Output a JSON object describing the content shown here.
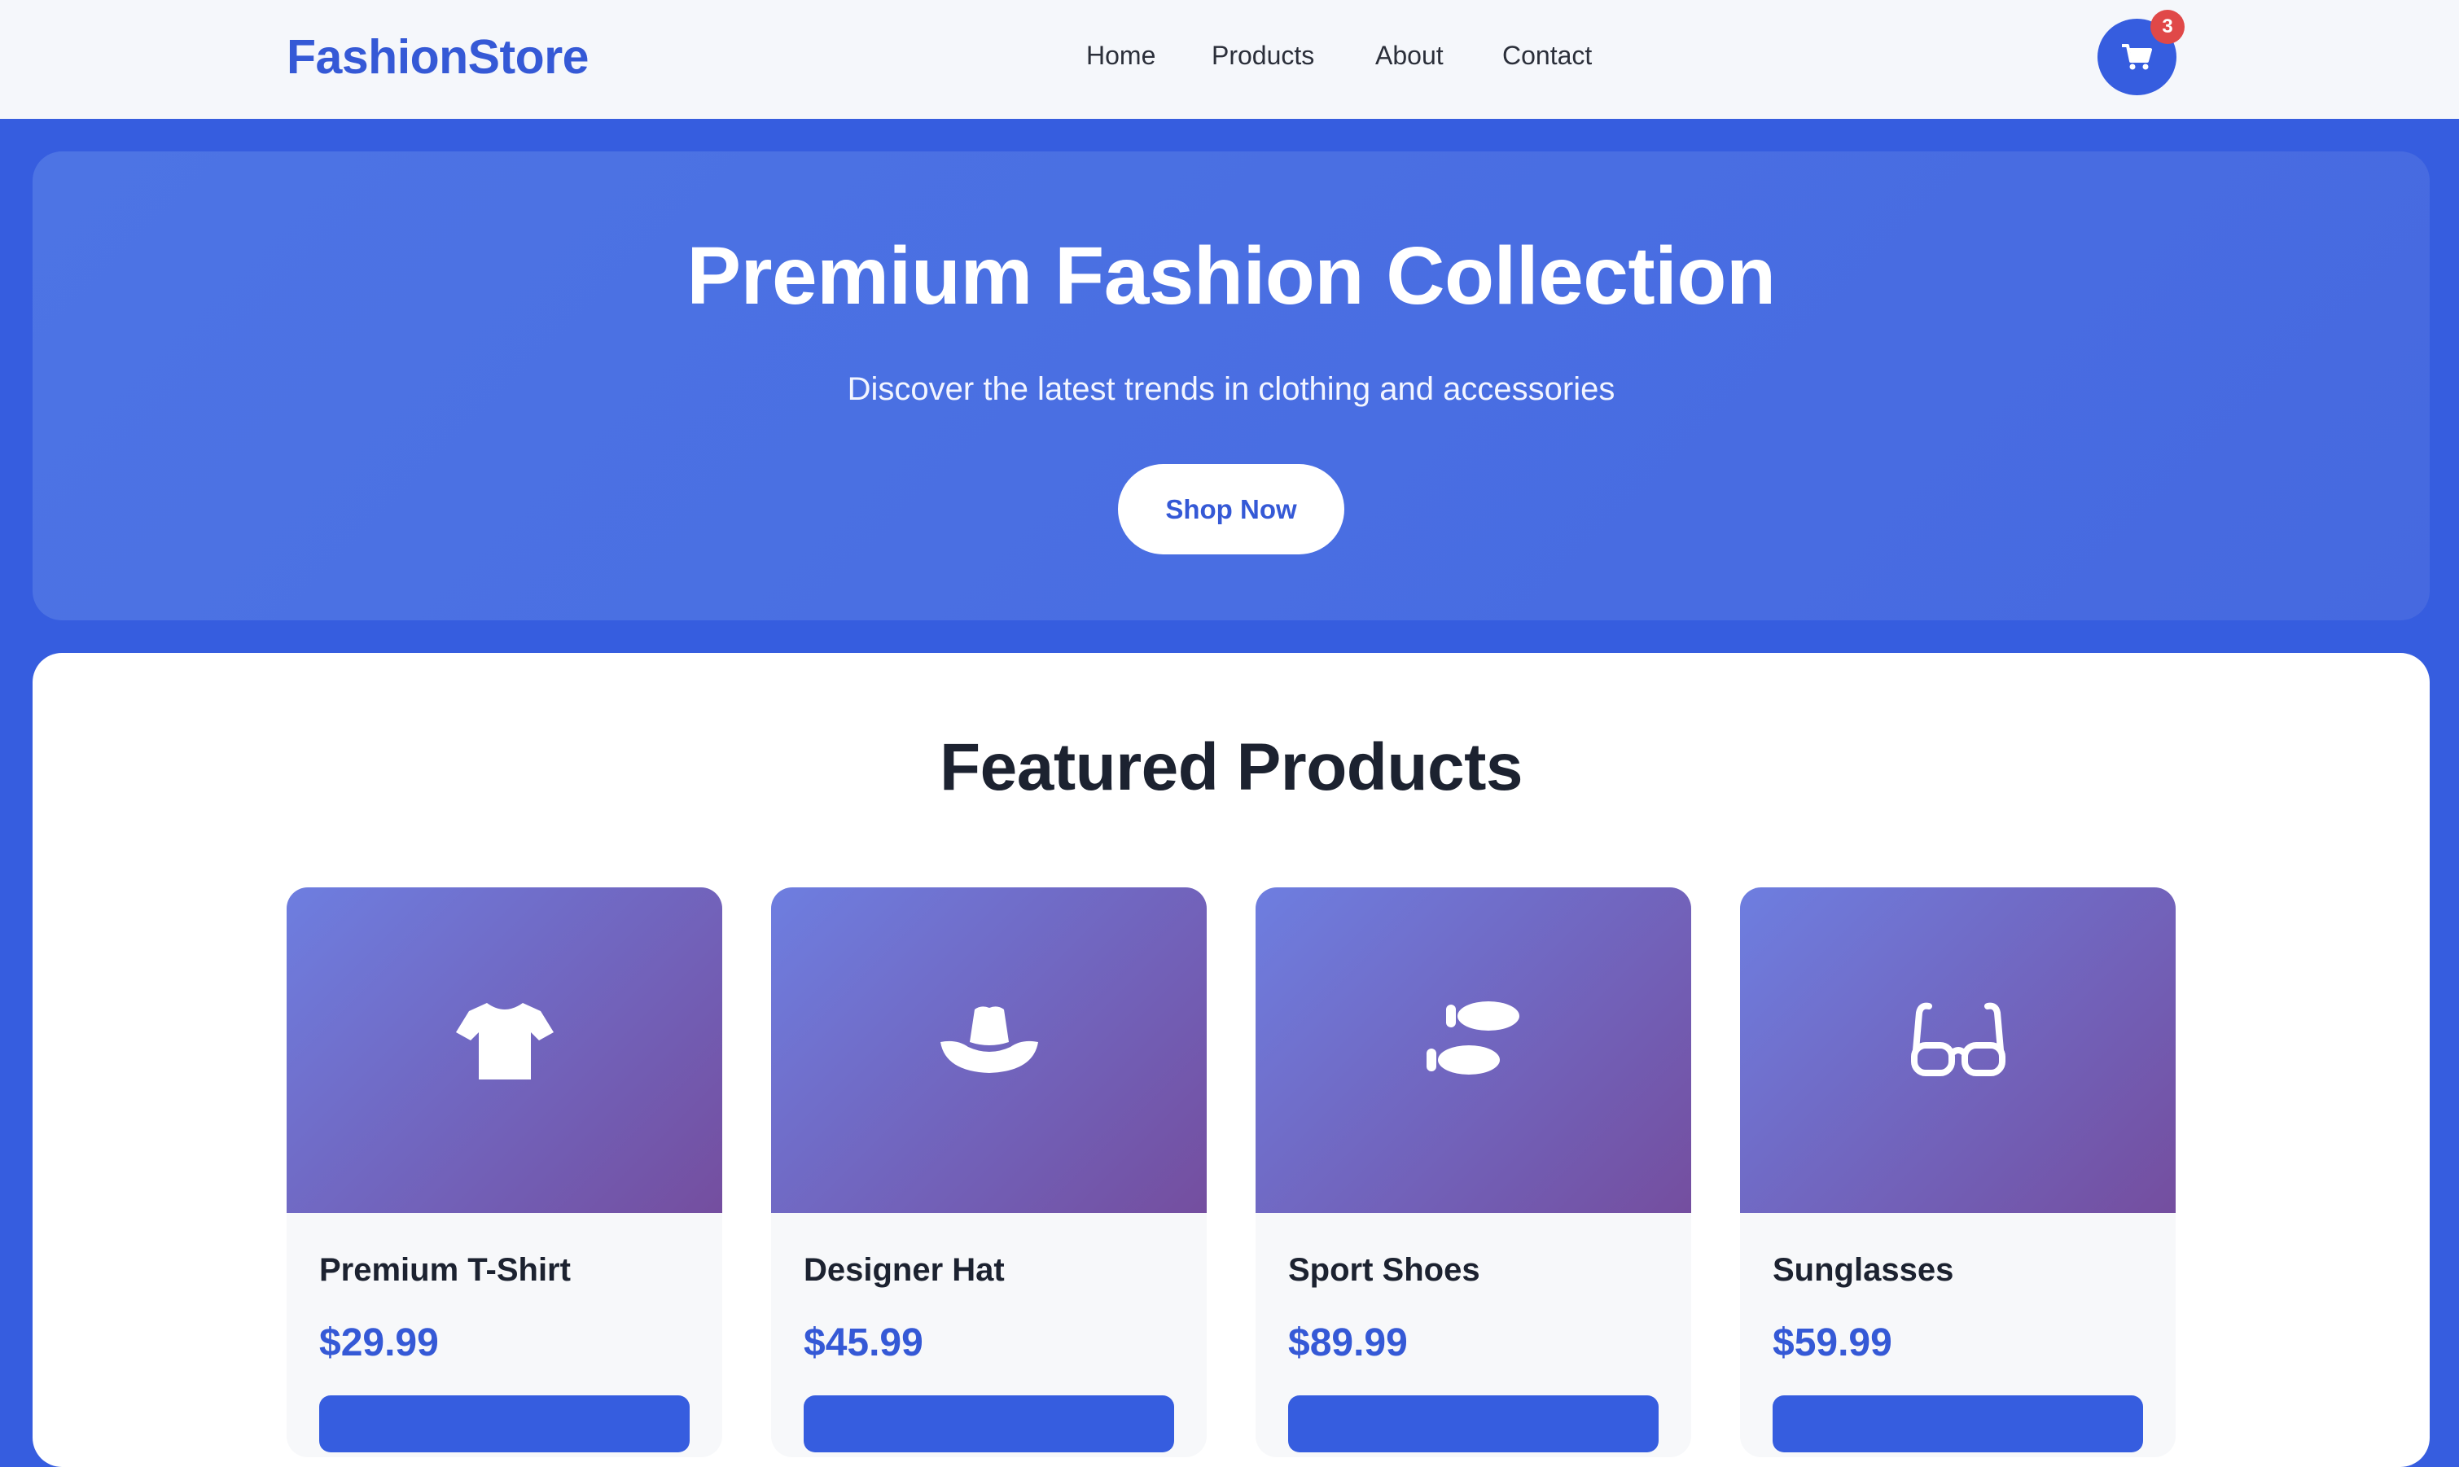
{
  "header": {
    "logo": "FashionStore",
    "nav": [
      "Home",
      "Products",
      "About",
      "Contact"
    ],
    "cart_count": "3"
  },
  "hero": {
    "title": "Premium Fashion Collection",
    "subtitle": "Discover the latest trends in clothing and accessories",
    "cta_label": "Shop Now"
  },
  "featured": {
    "title": "Featured Products",
    "products": [
      {
        "name": "Premium T-Shirt",
        "price": "$29.99",
        "icon": "tshirt-icon"
      },
      {
        "name": "Designer Hat",
        "price": "$45.99",
        "icon": "hat-icon"
      },
      {
        "name": "Sport Shoes",
        "price": "$89.99",
        "icon": "shoe-prints-icon"
      },
      {
        "name": "Sunglasses",
        "price": "$59.99",
        "icon": "glasses-icon"
      }
    ]
  },
  "colors": {
    "brand": "#3559d6",
    "background": "#365ddf",
    "badge": "#e04848",
    "card_gradient_start": "#6e7ee0",
    "card_gradient_end": "#744e9f"
  }
}
